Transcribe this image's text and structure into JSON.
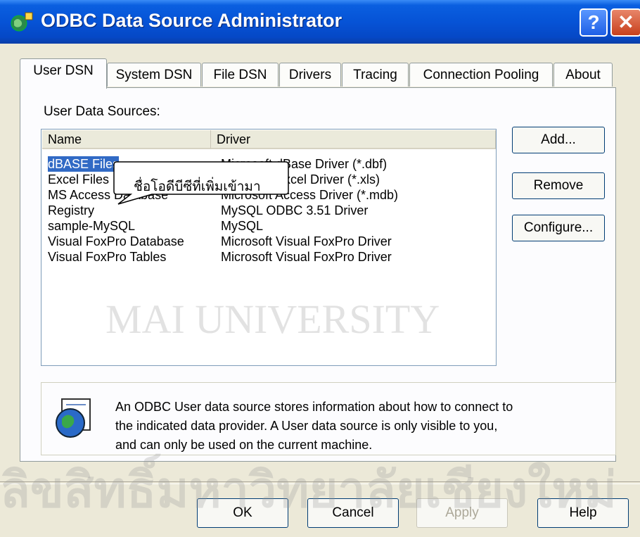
{
  "window": {
    "title": "ODBC Data Source Administrator",
    "help_glyph": "?",
    "close_glyph": "✕"
  },
  "tabs": [
    {
      "label": "User DSN",
      "active": true
    },
    {
      "label": "System DSN"
    },
    {
      "label": "File DSN"
    },
    {
      "label": "Drivers"
    },
    {
      "label": "Tracing"
    },
    {
      "label": "Connection Pooling"
    },
    {
      "label": "About"
    }
  ],
  "panel": {
    "list_label": "User Data Sources:",
    "columns": [
      "Name",
      "Driver"
    ],
    "rows": [
      {
        "name": "dBASE Files",
        "driver": "Microsoft dBase Driver (*.dbf)"
      },
      {
        "name": "Excel Files",
        "driver": "Microsoft Excel Driver (*.xls)"
      },
      {
        "name": "MS Access Database",
        "driver": "Microsoft Access Driver (*.mdb)"
      },
      {
        "name": "Registry",
        "driver": "MySQL ODBC 3.51 Driver"
      },
      {
        "name": "sample-MySQL",
        "driver": "MySQL"
      },
      {
        "name": "Visual FoxPro Database",
        "driver": "Microsoft Visual FoxPro Driver"
      },
      {
        "name": "Visual FoxPro Tables",
        "driver": "Microsoft Visual FoxPro Driver"
      }
    ],
    "buttons": {
      "add": "Add...",
      "remove": "Remove",
      "configure": "Configure..."
    },
    "info_lines": [
      "An ODBC User data source stores information about how to connect to",
      "the indicated data provider.   A User data source is only visible to you,",
      "and can only be used on the current machine."
    ]
  },
  "footer": {
    "ok": "OK",
    "cancel": "Cancel",
    "apply": "Apply",
    "help": "Help"
  },
  "callout": {
    "text": "ชื่อโอดีบีซีที่เพิ่มเข้ามา"
  },
  "watermark": {
    "top_text": "MAI UNIVERSITY",
    "bottom_text": "ลิขสิทธิ์มหาวิทยาลัยเชียงใหม่"
  },
  "icons": {
    "app": "odbc-globe-icon",
    "info": "globe-book-icon"
  },
  "colors": {
    "titlebar": "#0653d6",
    "selection": "#316ac5",
    "close_button": "#c8401c"
  }
}
